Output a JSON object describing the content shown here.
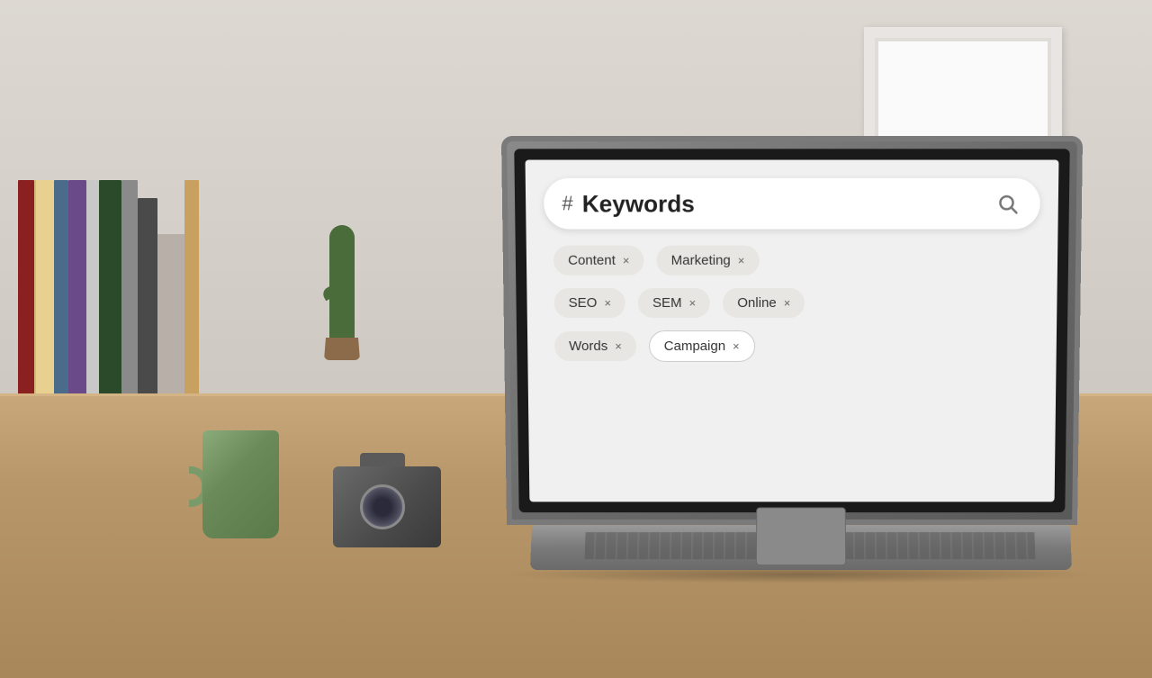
{
  "scene": {
    "search_bar": {
      "hash": "#",
      "placeholder": "Keywords",
      "search_icon": "🔍"
    },
    "tags": [
      [
        {
          "label": "Content",
          "x": "×"
        },
        {
          "label": "Marketing",
          "x": "×"
        }
      ],
      [
        {
          "label": "SEO",
          "x": "×"
        },
        {
          "label": "SEM",
          "x": "×"
        },
        {
          "label": "Online",
          "x": "×"
        }
      ],
      [
        {
          "label": "Words",
          "x": "×"
        },
        {
          "label": "Campaign",
          "x": "×",
          "highlighted": true
        }
      ]
    ]
  }
}
